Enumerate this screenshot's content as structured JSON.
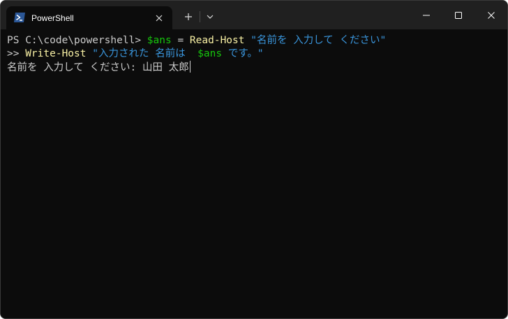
{
  "window": {
    "tab_title": "PowerShell",
    "tab_icon": "powershell-icon",
    "controls": [
      "close-icon",
      "plus-icon",
      "chevron-down-icon",
      "minimize-icon",
      "maximize-icon",
      "close-icon"
    ]
  },
  "colors": {
    "background": "#0c0c0c",
    "titlebar": "#202020",
    "text": "#cccccc",
    "variable": "#16c60c",
    "command": "#f9f1a5",
    "string": "#3a96dd"
  },
  "terminal": {
    "line1": {
      "prompt": "PS C:\\code\\powershell> ",
      "var": "$ans",
      "op": " = ",
      "cmd": "Read-Host",
      "space": " ",
      "str": "\"名前を 入力して ください\""
    },
    "line2": {
      "continuation": ">> ",
      "cmd": "Write-Host",
      "space": " ",
      "str1": "\"入力された 名前は  ",
      "var": "$ans",
      "str2": " です。\""
    },
    "line3": {
      "prompt_text": "名前を 入力して ください: ",
      "input": "山田 太郎"
    }
  }
}
